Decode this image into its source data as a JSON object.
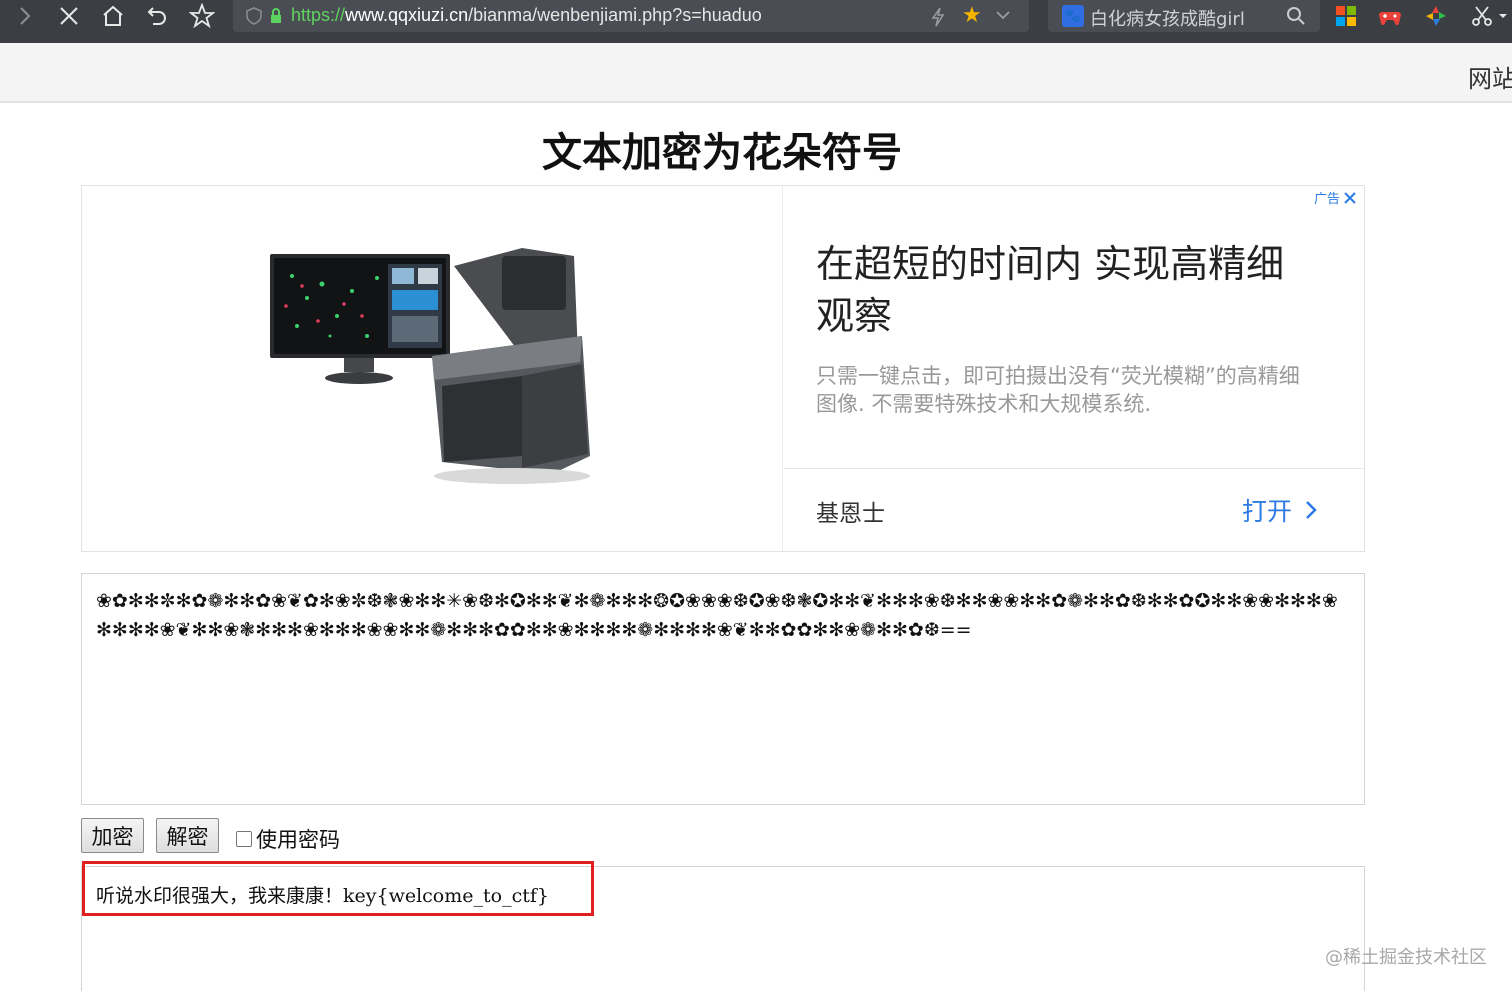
{
  "browser": {
    "url": {
      "scheme": "https://",
      "host": "www.qqxiuzi.cn",
      "path": "/bianma/wenbenjiami.php?s=huaduo"
    },
    "search_text": "白化病女孩成酷girl",
    "infobar_text": "网站"
  },
  "page": {
    "title": "文本加密为花朵符号"
  },
  "ad": {
    "tag": "广告",
    "headline": "在超短的时间内 实现高精细观察",
    "description": "只需一键点击，即可拍摄出没有“荧光模糊”的高精细图像. 不需要特殊技术和大规模系统.",
    "brand": "基恩士",
    "open_label": "打开"
  },
  "cipher": {
    "text": "❀✿✻✻✼✻✿❁✻✻✿❀❦✿✻❀✼❆❃❀✻✻✳❀❆✻✪✻✻❦✻❁✻✻✻❂✪❀❀❀❆✪❀❆❃✪✻✻❦✻✻✻❀❆✻✻❀❀✻✻✿❁✻✻✿❆✻✻✿✪✻✻❀❀✻✻✻❀✻✻✻✻❀❦✻✻❀❃✻✻✻❀✻✻✻❀❀✻✻❁✻✻✻✿✿✻✻❀✻✻✻✻❁✻✻✻✻❀❦✻✻✿✿✻✻❀❁✻✻✿❆=="
  },
  "controls": {
    "encrypt_label": "加密",
    "decrypt_label": "解密",
    "use_password_label": "使用密码"
  },
  "result": {
    "text": "听说水印很强大，我来康康！key{welcome_to_ctf}"
  },
  "watermark": "@稀土掘金技术社区",
  "colors": {
    "toolbar_bg": "#3b3e43",
    "link_blue": "#2c7be5",
    "highlight_red": "#e0201f"
  }
}
